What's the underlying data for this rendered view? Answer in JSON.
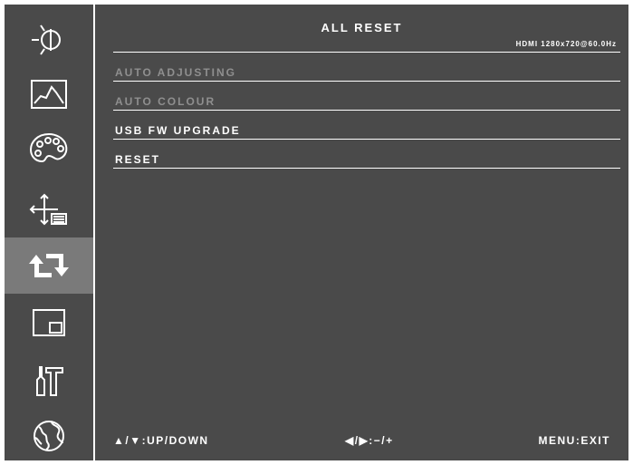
{
  "sidebar": {
    "items": [
      {
        "icon": "brightness-icon",
        "active": false
      },
      {
        "icon": "picture-icon",
        "active": false
      },
      {
        "icon": "color-palette-icon",
        "active": false
      },
      {
        "icon": "position-icon",
        "active": false
      },
      {
        "icon": "reset-icon",
        "active": true
      },
      {
        "icon": "pip-icon",
        "active": false
      },
      {
        "icon": "tools-icon",
        "active": false
      },
      {
        "icon": "globe-icon",
        "active": false
      }
    ]
  },
  "main": {
    "title": "ALL RESET",
    "signal": "HDMI 1280x720@60.0Hz",
    "items": [
      {
        "label": "AUTO ADJUSTING",
        "enabled": false
      },
      {
        "label": "AUTO COLOUR",
        "enabled": false
      },
      {
        "label": "USB FW UPGRADE",
        "enabled": true
      },
      {
        "label": "RESET",
        "enabled": true
      }
    ]
  },
  "footer": {
    "updown": "▲/▼:UP/DOWN",
    "adjust": "◀/▶:−/+",
    "exit": "MENU:EXIT"
  },
  "colors": {
    "panel": "#4a4a4a",
    "active": "#7a7a7a",
    "text": "#ffffff",
    "disabled_text": "#8f8f8f"
  }
}
